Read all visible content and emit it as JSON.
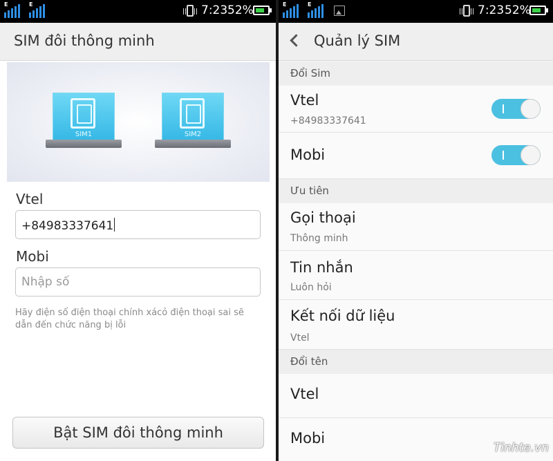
{
  "left": {
    "status": {
      "time": "7:23",
      "battery": "52%",
      "network_type": "E"
    },
    "header_title": "SIM đôi thông minh",
    "illustration": {
      "sim1_label": "SIM1",
      "sim2_label": "SIM2"
    },
    "vtel_label": "Vtel",
    "vtel_value": "+84983337641",
    "mobi_label": "Mobi",
    "mobi_placeholder": "Nhập số",
    "hint": "Hãy điện số điện thoại chính xácỏ điện thoại sai sẽ dẫn đến chức năng bị lỗi",
    "enable_button": "Bật SIM đôi thông minh"
  },
  "right": {
    "status": {
      "time": "7:23",
      "battery": "52%",
      "network_type": "E"
    },
    "header_title": "Quản lý SIM",
    "sections": {
      "switch_sim": "Đổi Sim",
      "priority": "Ưu tiên",
      "rename": "Đổi tên"
    },
    "sim_vtel": {
      "name": "Vtel",
      "number": "+84983337641",
      "enabled": true
    },
    "sim_mobi": {
      "name": "Mobi",
      "enabled": true
    },
    "calls": {
      "label": "Gọi thoại",
      "value": "Thông minh"
    },
    "messages": {
      "label": "Tin nhắn",
      "value": "Luôn hỏi"
    },
    "data": {
      "label": "Kết nối dữ liệu",
      "value": "Vtel"
    },
    "rename_vtel": "Vtel",
    "rename_mobi": "Mobi"
  },
  "watermark": "Tinhte.vn",
  "colors": {
    "toggle_on": "#4cc0e0",
    "sim_screen": "#35b8e6",
    "battery": "#3ed24a",
    "signal": "#2f8fe6"
  },
  "icons": [
    "signal-icon",
    "gallery-icon",
    "vibrate-icon",
    "battery-icon",
    "back-icon",
    "sim-card-icon"
  ]
}
